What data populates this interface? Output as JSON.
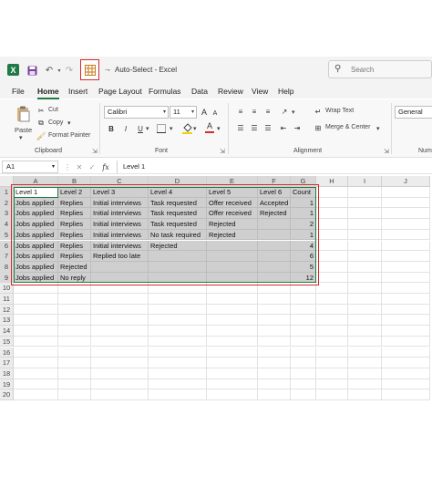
{
  "titlebar": {
    "title": "Auto-Select  -  Excel",
    "search_placeholder": "Search"
  },
  "menu": {
    "tabs": [
      "File",
      "Home",
      "Insert",
      "Page Layout",
      "Formulas",
      "Data",
      "Review",
      "View",
      "Help"
    ],
    "active": "Home"
  },
  "ribbon": {
    "clipboard": {
      "paste": "Paste",
      "cut": "Cut",
      "copy": "Copy",
      "format_painter": "Format Painter",
      "label": "Clipboard"
    },
    "font": {
      "name": "Calibri",
      "size": "11",
      "grow": "A",
      "shrink": "A",
      "bold": "B",
      "italic": "I",
      "underline": "U",
      "color_letter": "A",
      "label": "Font"
    },
    "alignment": {
      "wrap_text": "Wrap Text",
      "merge_center": "Merge & Center",
      "label": "Alignment"
    },
    "number": {
      "format": "General",
      "label": "Num"
    },
    "colors": {
      "accent": "#1f7a45",
      "highlight_red": "#d62b2b",
      "fill_yellow": "#f5d000",
      "font_red": "#d62b2b"
    }
  },
  "formula_bar": {
    "cell_ref": "A1",
    "fx": "fx",
    "value": "Level 1"
  },
  "grid": {
    "columns": [
      "A",
      "B",
      "C",
      "D",
      "E",
      "F",
      "G",
      "H",
      "I",
      "J"
    ],
    "rows": [
      "1",
      "2",
      "3",
      "4",
      "5",
      "6",
      "7",
      "8",
      "9",
      "10",
      "11",
      "12",
      "13",
      "14",
      "15",
      "16",
      "17",
      "18",
      "19",
      "20"
    ],
    "cells": [
      [
        "Level 1",
        "Level 2",
        "Level 3",
        "Level 4",
        "Level 5",
        "Level 6",
        "Count"
      ],
      [
        "Jobs applied",
        "Replies",
        "Initial interviews",
        "Task requested",
        "Offer received",
        "Accepted",
        "1"
      ],
      [
        "Jobs applied",
        "Replies",
        "Initial interviews",
        "Task requested",
        "Offer received",
        "Rejected",
        "1"
      ],
      [
        "Jobs applied",
        "Replies",
        "Initial interviews",
        "Task requested",
        "Rejected",
        "",
        "2"
      ],
      [
        "Jobs applied",
        "Replies",
        "Initial interviews",
        "No task required",
        "Rejected",
        "",
        "1"
      ],
      [
        "Jobs applied",
        "Replies",
        "Initial interviews",
        "Rejected",
        "",
        "",
        "4"
      ],
      [
        "Jobs applied",
        "Replies",
        "Replied too late",
        "",
        "",
        "",
        "6"
      ],
      [
        "Jobs applied",
        "Rejected",
        "",
        "",
        "",
        "",
        "5"
      ],
      [
        "Jobs applied",
        "No reply",
        "",
        "",
        "",
        "",
        "12"
      ]
    ]
  }
}
